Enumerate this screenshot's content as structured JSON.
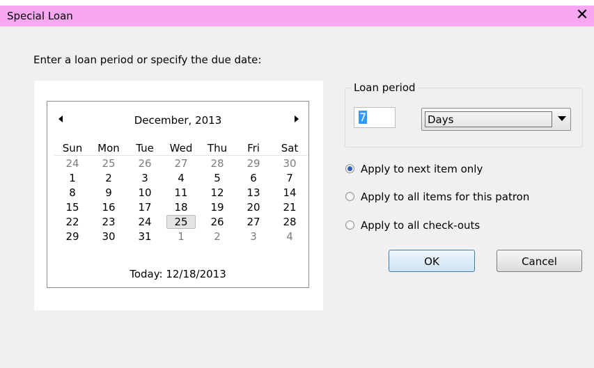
{
  "window": {
    "title": "Special Loan",
    "close_label": "✕"
  },
  "prompt": "Enter a loan period or specify the due date:",
  "calendar": {
    "month_label": "December, 2013",
    "prev_icon": "triangle-left-icon",
    "next_icon": "triangle-right-icon",
    "weekdays": [
      "Sun",
      "Mon",
      "Tue",
      "Wed",
      "Thu",
      "Fri",
      "Sat"
    ],
    "weeks": [
      [
        "24",
        "25",
        "26",
        "27",
        "28",
        "29",
        "30"
      ],
      [
        "1",
        "2",
        "3",
        "4",
        "5",
        "6",
        "7"
      ],
      [
        "8",
        "9",
        "10",
        "11",
        "12",
        "13",
        "14"
      ],
      [
        "15",
        "16",
        "17",
        "18",
        "19",
        "20",
        "21"
      ],
      [
        "22",
        "23",
        "24",
        "25",
        "26",
        "27",
        "28"
      ],
      [
        "29",
        "30",
        "31",
        "1",
        "2",
        "3",
        "4"
      ]
    ],
    "selected_day": "25",
    "today_label": "Today: 12/18/2013"
  },
  "loan_period": {
    "group_label": "Loan period",
    "value": "7",
    "unit_selected": "Days"
  },
  "apply_options": [
    {
      "label": "Apply to next item only",
      "selected": true
    },
    {
      "label": "Apply to all items for this patron",
      "selected": false
    },
    {
      "label": "Apply to all check-outs",
      "selected": false
    }
  ],
  "buttons": {
    "ok": "OK",
    "cancel": "Cancel"
  },
  "colors": {
    "titlebar": "#f7a8f1",
    "dialog_bg": "#f0f0f0",
    "radio_selected": "#2d5fb5"
  }
}
